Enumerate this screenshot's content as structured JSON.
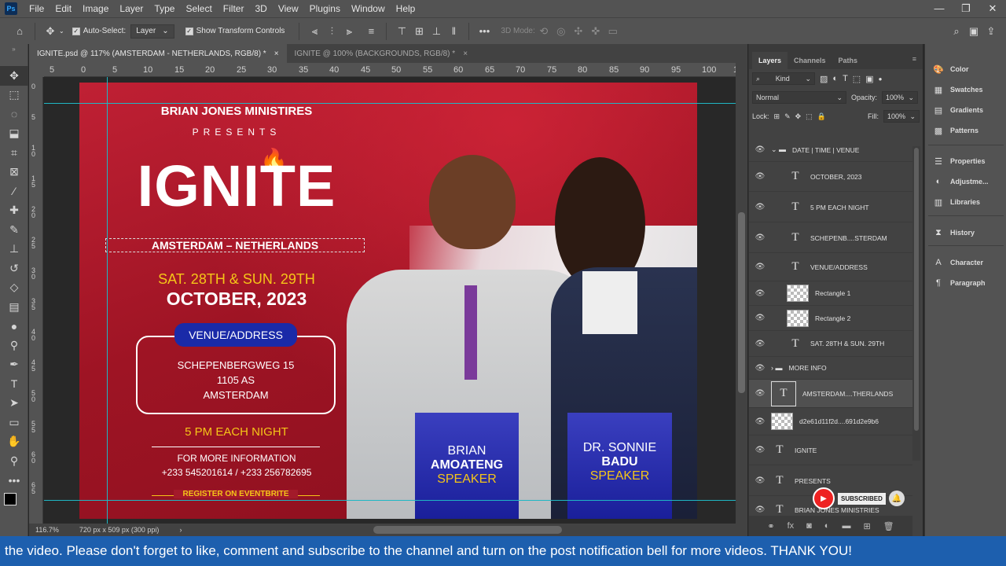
{
  "menubar": {
    "logo": "Ps",
    "items": [
      "File",
      "Edit",
      "Image",
      "Layer",
      "Type",
      "Select",
      "Filter",
      "3D",
      "View",
      "Plugins",
      "Window",
      "Help"
    ],
    "window_controls": [
      "—",
      "❐",
      "✕"
    ]
  },
  "options": {
    "auto_select_label": "Auto-Select:",
    "auto_select_value": "Layer",
    "show_transform_label": "Show Transform Controls",
    "mode_3d": "3D Mode:"
  },
  "tabs": [
    {
      "label": "IGNITE.psd @ 117% (AMSTERDAM - NETHERLANDS, RGB/8) *",
      "close": "×"
    },
    {
      "label": "IGNITE @ 100% (BACKGROUNDS, RGB/8) *",
      "close": "×"
    }
  ],
  "ruler": {
    "h_ticks": [
      "5",
      "0",
      "5",
      "10",
      "15",
      "20",
      "25",
      "30",
      "35",
      "40",
      "45",
      "50",
      "55",
      "60",
      "65",
      "70",
      "75",
      "80",
      "85",
      "90",
      "95",
      "100",
      "105"
    ],
    "v_ticks": [
      "0",
      "5",
      "1\n0",
      "1\n5",
      "2\n0",
      "2\n5",
      "3\n0",
      "3\n5",
      "4\n0",
      "4\n5",
      "5\n0",
      "5\n5",
      "6\n0",
      "6\n5"
    ]
  },
  "status": {
    "zoom": "116.7%",
    "doc_info": "720 px x 509 px (300 ppi)",
    "arrow": "›"
  },
  "artwork": {
    "org": "BRIAN JONES MINISTIRES",
    "presents": "PRESENTS",
    "title": "IGNITE",
    "location": "AMSTERDAM – NETHERLANDS",
    "dates": "SAT. 28TH & SUN. 29TH",
    "month": "OCTOBER, 2023",
    "venue_label": "VENUE/ADDRESS",
    "address_1": "SCHEPENBERGWEG 15",
    "address_2": "1105 AS",
    "address_3": "AMSTERDAM",
    "time_bold": "5 PM",
    "time_rest": " EACH NIGHT",
    "more_info": "FOR MORE INFORMATION",
    "phones": "+233 545201614 / +233 256782695",
    "register": "REGISTER ON  EVENTBRITE",
    "speaker1_first": "BRIAN",
    "speaker1_last": "AMOATENG",
    "speaker1_role": "SPEAKER",
    "speaker2_first": "DR. SONNIE",
    "speaker2_last": "BADU",
    "speaker2_role": "SPEAKER"
  },
  "layers_panel": {
    "tabs": [
      "Layers",
      "Channels",
      "Paths"
    ],
    "filter_kind": "Kind",
    "blend_mode": "Normal",
    "opacity_label": "Opacity:",
    "opacity_value": "100%",
    "lock_label": "Lock:",
    "fill_label": "Fill:",
    "fill_value": "100%",
    "layers": [
      {
        "name": "DATE | TIME | VENUE",
        "kind": "group"
      },
      {
        "name": "OCTOBER, 2023",
        "kind": "text"
      },
      {
        "name": "5 PM EACH NIGHT",
        "kind": "text"
      },
      {
        "name": "SCHEPENB....STERDAM",
        "kind": "text"
      },
      {
        "name": "VENUE/ADDRESS",
        "kind": "text"
      },
      {
        "name": "Rectangle 1",
        "kind": "shape"
      },
      {
        "name": "Rectangle 2",
        "kind": "shape"
      },
      {
        "name": "SAT. 28TH & SUN. 29TH",
        "kind": "text"
      },
      {
        "name": "MORE INFO",
        "kind": "group"
      },
      {
        "name": "AMSTERDAM....THERLANDS",
        "kind": "text"
      },
      {
        "name": "d2e61d11f2d....691d2e9b6",
        "kind": "image"
      },
      {
        "name": "IGNITE",
        "kind": "text"
      },
      {
        "name": "PRESENTS",
        "kind": "text"
      },
      {
        "name": "BRIAN JONES MINISTRIES",
        "kind": "text"
      }
    ]
  },
  "side_panel": {
    "items": [
      "Color",
      "Swatches",
      "Gradients",
      "Patterns",
      "Properties",
      "Adjustme...",
      "Libraries",
      "History",
      "Character",
      "Paragraph"
    ]
  },
  "subscribe": {
    "label": "SUBSCRIBED"
  },
  "subtitle": "the video. Please don't forget to like, comment and subscribe to the channel and turn on the post notification bell for more videos. THANK YOU!",
  "colors": {
    "brand_red": "#a31a2a",
    "accent_yellow": "#f5c518",
    "banner_blue": "#1d5fae",
    "guide_cyan": "#1fb7c4"
  }
}
